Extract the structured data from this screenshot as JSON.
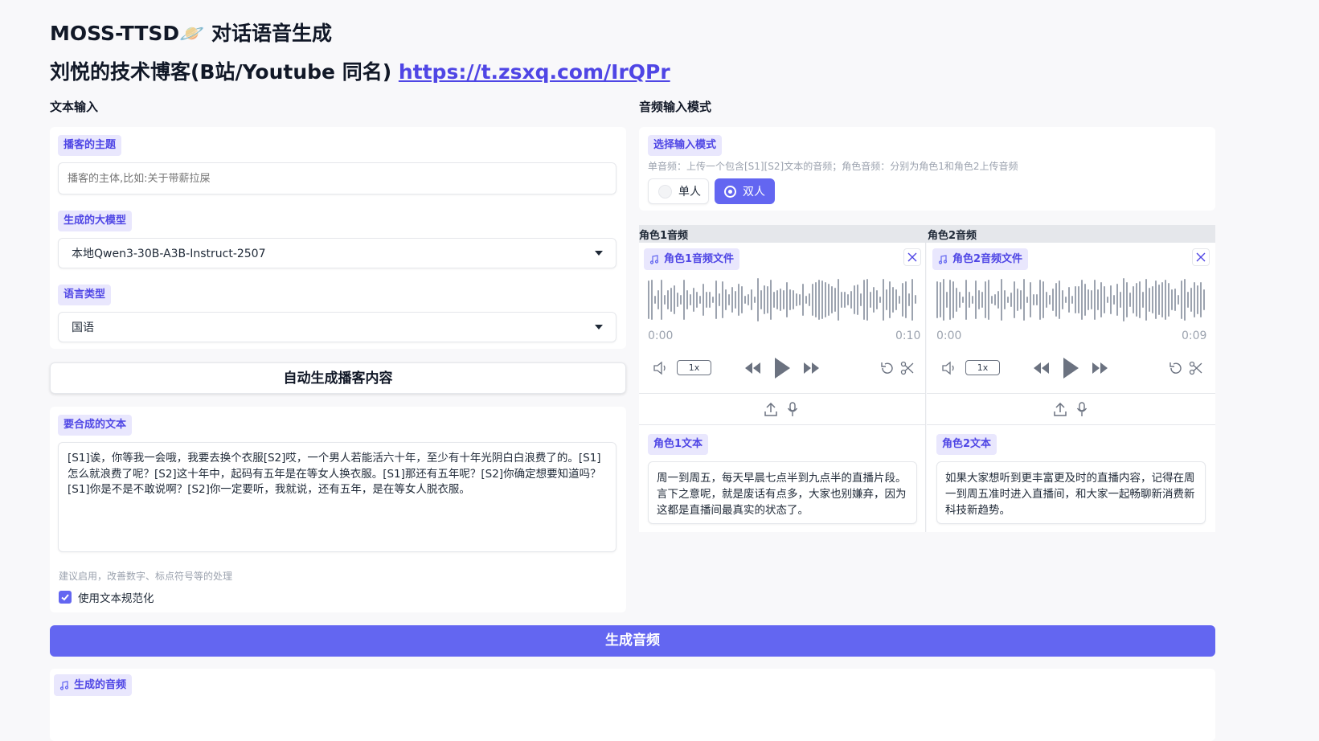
{
  "header": {
    "title": "MOSS-TTSD🪐 对话语音生成",
    "subtitle_prefix": "刘悦的技术博客(B站/Youtube 同名)",
    "subtitle_link": "https://t.zsxq.com/IrQPr"
  },
  "left": {
    "section_title": "文本输入",
    "topic": {
      "label": "播客的主题",
      "placeholder": "播客的主体,比如:关于带薪拉屎"
    },
    "model": {
      "label": "生成的大模型",
      "value": "本地Qwen3-30B-A3B-Instruct-2507"
    },
    "language": {
      "label": "语言类型",
      "value": "国语"
    },
    "auto_button": "自动生成播客内容",
    "synth": {
      "label": "要合成的文本",
      "value": "[S1]诶，你等我一会哦，我要去换个衣服[S2]哎，一个男人若能活六十年，至少有十年光阴白白浪费了的。[S1]怎么就浪费了呢？[S2]这十年中，起码有五年是在等女人换衣服。[S1]那还有五年呢？[S2]你确定想要知道吗？[S1]你是不是不敢说啊？[S2]你一定要听，我就说，还有五年，是在等女人脱衣服。",
      "hint": "建议启用，改善数字、标点符号等的处理",
      "checkbox_label": "使用文本规范化",
      "checked": true
    }
  },
  "right": {
    "section_title": "音频输入模式",
    "mode": {
      "label": "选择输入模式",
      "info": "单音频：上传一个包含[S1][S2]文本的音频；角色音频：分别为角色1和角色2上传音频",
      "options": [
        "单人",
        "双人"
      ],
      "selected": "双人"
    },
    "role1": {
      "header": "角色1音频",
      "file_label": "角色1音频文件",
      "time_start": "0:00",
      "time_end": "0:10",
      "speed": "1x",
      "text_label": "角色1文本",
      "text": "周一到周五，每天早晨七点半到九点半的直播片段。言下之意呢，就是废话有点多，大家也别嫌弃，因为这都是直播间最真实的状态了。"
    },
    "role2": {
      "header": "角色2音频",
      "file_label": "角色2音频文件",
      "time_start": "0:00",
      "time_end": "0:09",
      "speed": "1x",
      "text_label": "角色2文本",
      "text": "如果大家想听到更丰富更及时的直播内容，记得在周一到周五准时进入直播间，和大家一起畅聊新消费新科技新趋势。"
    }
  },
  "generate_button": "生成音频",
  "output": {
    "label": "生成的音频"
  },
  "colors": {
    "accent": "#6366f1",
    "tag_bg": "#e9e7fd",
    "tag_text": "#4f46e5"
  },
  "icons": [
    "music-icon",
    "close-icon",
    "volume-icon",
    "rewind-icon",
    "play-icon",
    "fast-forward-icon",
    "undo-icon",
    "scissors-icon",
    "upload-icon",
    "microphone-icon",
    "chevron-down-icon",
    "checkbox-check-icon",
    "radio-dot-icon"
  ]
}
